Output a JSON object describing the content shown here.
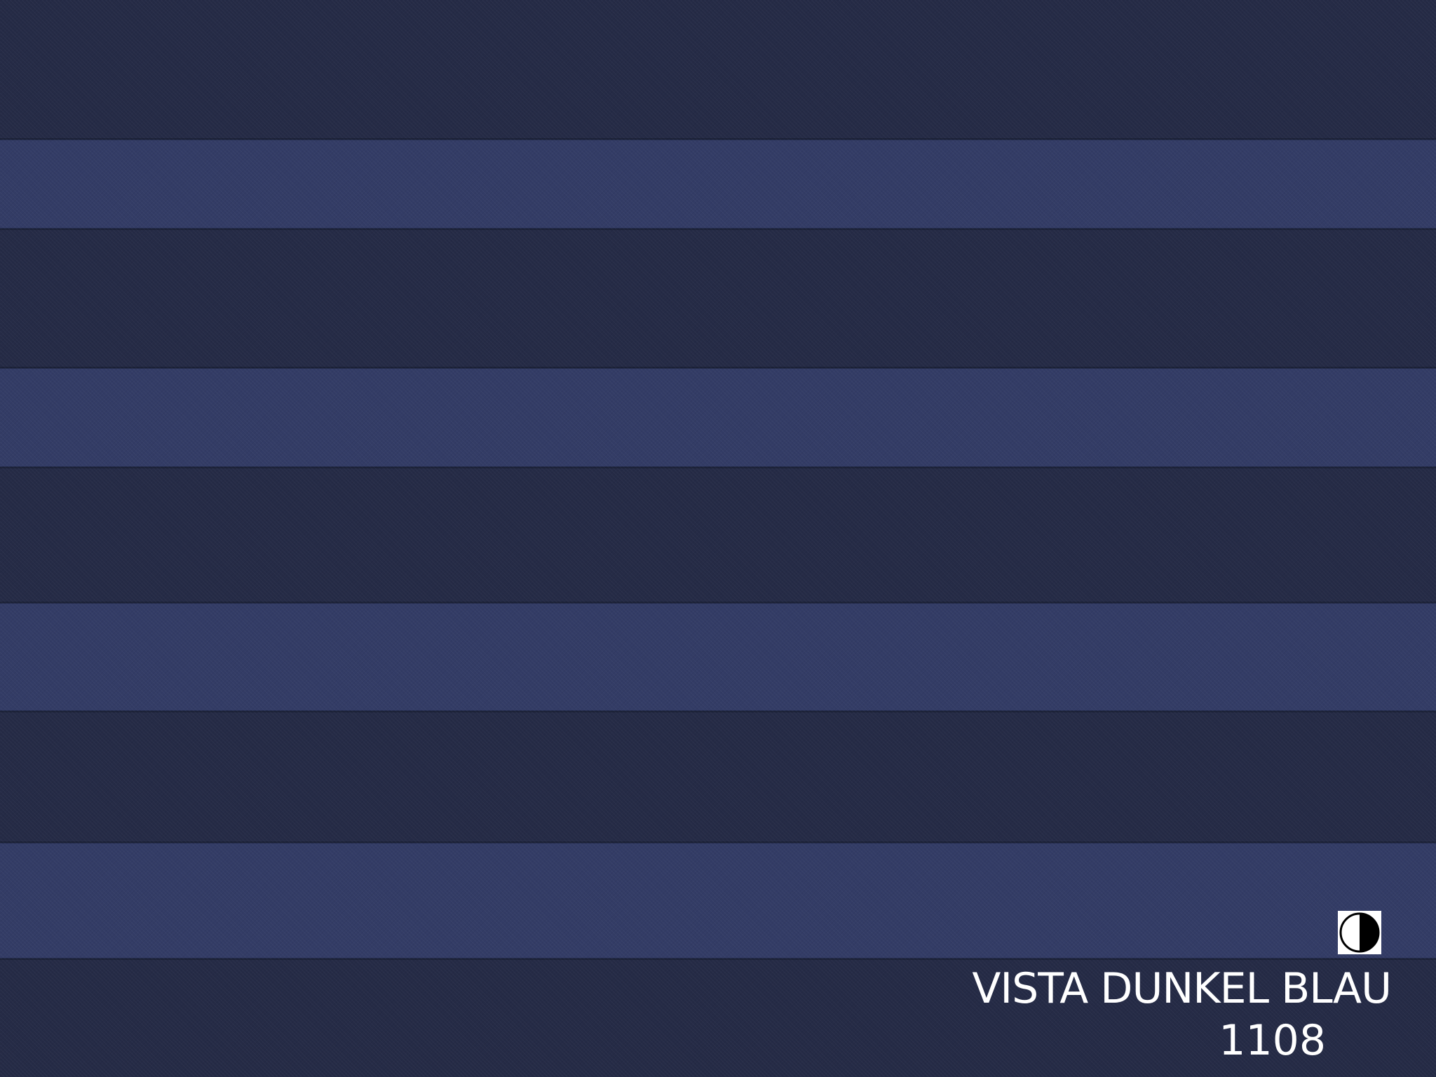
{
  "product": {
    "name": "VISTA DUNKEL BLAU",
    "code": "1108",
    "opacity_icon": "half-filled-circle-icon"
  },
  "colors": {
    "dark_stripe": "#252b46",
    "light_stripe": "#333c66",
    "text": "#ffffff",
    "icon_background": "#ffffff"
  }
}
